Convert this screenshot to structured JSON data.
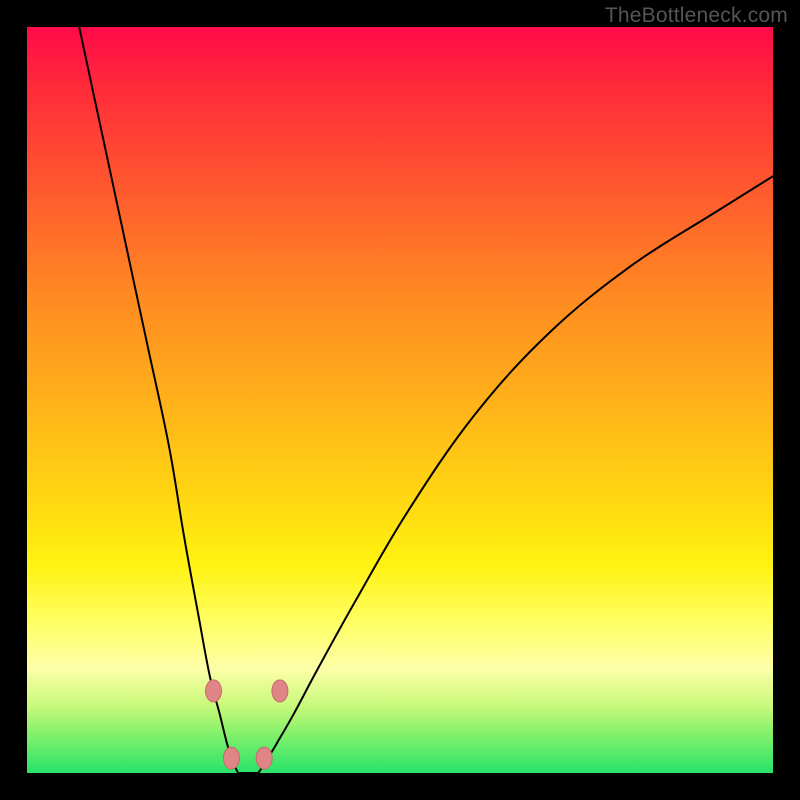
{
  "watermark": "TheBottleneck.com",
  "colors": {
    "gradient_top": "#ff0a4a",
    "gradient_bottom": "#28e36a",
    "curve": "#000000",
    "dot_fill": "#e08585",
    "dot_stroke": "#c56a6a",
    "background": "#000000"
  },
  "chart_data": {
    "type": "line",
    "title": "",
    "xlabel": "",
    "ylabel": "",
    "xlim": [
      0,
      100
    ],
    "ylim": [
      0,
      100
    ],
    "series": [
      {
        "name": "left-branch",
        "x": [
          7,
          10,
          13,
          16,
          19,
          21,
          23,
          24.5,
          25.8,
          26.8,
          27.6,
          28.3
        ],
        "y": [
          100,
          86,
          72,
          58,
          44,
          32,
          21,
          13,
          8,
          4,
          1.5,
          0
        ]
      },
      {
        "name": "right-branch",
        "x": [
          31.0,
          32.0,
          33.5,
          35.8,
          39,
          44,
          51,
          60,
          70,
          81,
          92,
          100
        ],
        "y": [
          0,
          1.5,
          4,
          8,
          14,
          23,
          35,
          48,
          59,
          68,
          75,
          80
        ]
      }
    ],
    "markers": [
      {
        "name": "left-dot-upper",
        "x": 25.0,
        "y": 11
      },
      {
        "name": "left-dot-lower",
        "x": 27.4,
        "y": 2
      },
      {
        "name": "right-dot-lower",
        "x": 31.8,
        "y": 2
      },
      {
        "name": "right-dot-upper",
        "x": 33.9,
        "y": 11
      }
    ],
    "background_gradient": "vertical red→orange→yellow→green"
  }
}
